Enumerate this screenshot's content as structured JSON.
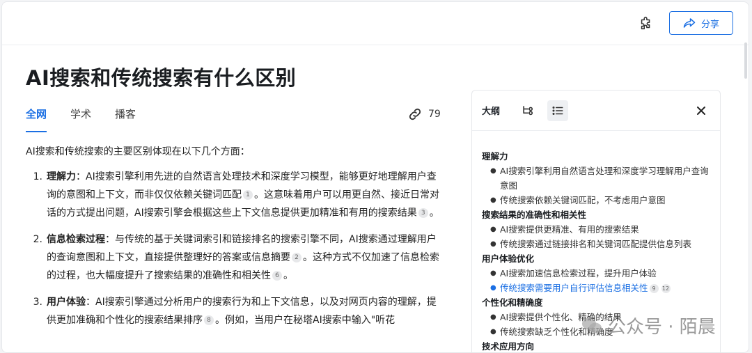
{
  "header": {
    "share_label": "分享",
    "plugin_icon": "puzzle-icon",
    "share_icon": "share-arrow-icon"
  },
  "title": "AI搜索和传统搜索有什么区别",
  "tabs": [
    {
      "label": "全网",
      "active": true
    },
    {
      "label": "学术",
      "active": false
    },
    {
      "label": "播客",
      "active": false
    }
  ],
  "link_count": "79",
  "content": {
    "intro": "AI搜索和传统搜索的主要区别体现在以下几个方面：",
    "items": [
      {
        "num": "1.",
        "term": "理解力",
        "p1": "：AI搜索引擎利用先进的自然语言处理技术和深度学习模型，能够更好地理解用户查询的意图和上下文，而非仅仅依赖关键词匹配",
        "c1": "1",
        "p2": "。这意味着用户可以用更自然、接近日常对话的方式提出问题，AI搜索引擎会根据这些上下文信息提供更加精准和有用的搜索结果",
        "c2": "3",
        "p3": "。"
      },
      {
        "num": "2.",
        "term": "信息检索过程",
        "p1": "：与传统的基于关键词索引和链接排名的搜索引擎不同，AI搜索通过理解用户的查询意图和上下文，直接提供整理好的答案或信息摘要",
        "c1": "2",
        "p2": "。这种方式不仅加速了信息检索的过程，也大幅度提升了搜索结果的准确性和相关性",
        "c2": "6",
        "p3": "。"
      },
      {
        "num": "3.",
        "term": "用户体验",
        "p1": "：AI搜索引擎通过分析用户的搜索行为和上下文信息，以及对网页内容的理解，提供更加准确和个性化的搜索结果排序",
        "c1": "8",
        "p2": "。例如，当用户在秘塔AI搜索中输入\"听花",
        "c2": "",
        "p3": ""
      }
    ]
  },
  "outline": {
    "label": "大纲",
    "sections": [
      {
        "title": "理解力",
        "bullets": [
          {
            "text": "AI搜索引擎利用自然语言处理和深度学习理解用户查询意图",
            "link": false,
            "cites": []
          },
          {
            "text": "传统搜索依赖关键词匹配，不考虑用户意图",
            "link": false,
            "cites": []
          }
        ]
      },
      {
        "title": "搜索结果的准确性和相关性",
        "bullets": [
          {
            "text": "AI搜索提供更精准、有用的搜索结果",
            "link": false,
            "cites": []
          },
          {
            "text": "传统搜索通过链接排名和关键词匹配提供信息列表",
            "link": false,
            "cites": []
          }
        ]
      },
      {
        "title": "用户体验优化",
        "bullets": [
          {
            "text": "AI搜索加速信息检索过程，提升用户体验",
            "link": false,
            "cites": []
          },
          {
            "text": "传统搜索需要用户自行评估信息相关性",
            "link": true,
            "cites": [
              "9",
              "12"
            ]
          }
        ]
      },
      {
        "title": "个性化和精确度",
        "bullets": [
          {
            "text": "AI搜索提供个性化、精确的结果",
            "link": false,
            "cites": []
          },
          {
            "text": "传统搜索缺乏个性化和精确度",
            "link": false,
            "cites": []
          }
        ]
      },
      {
        "title": "技术应用方向",
        "bullets": []
      }
    ]
  },
  "watermark": "公众号 · 陌晨",
  "colors": {
    "accent": "#1b6fe3"
  }
}
